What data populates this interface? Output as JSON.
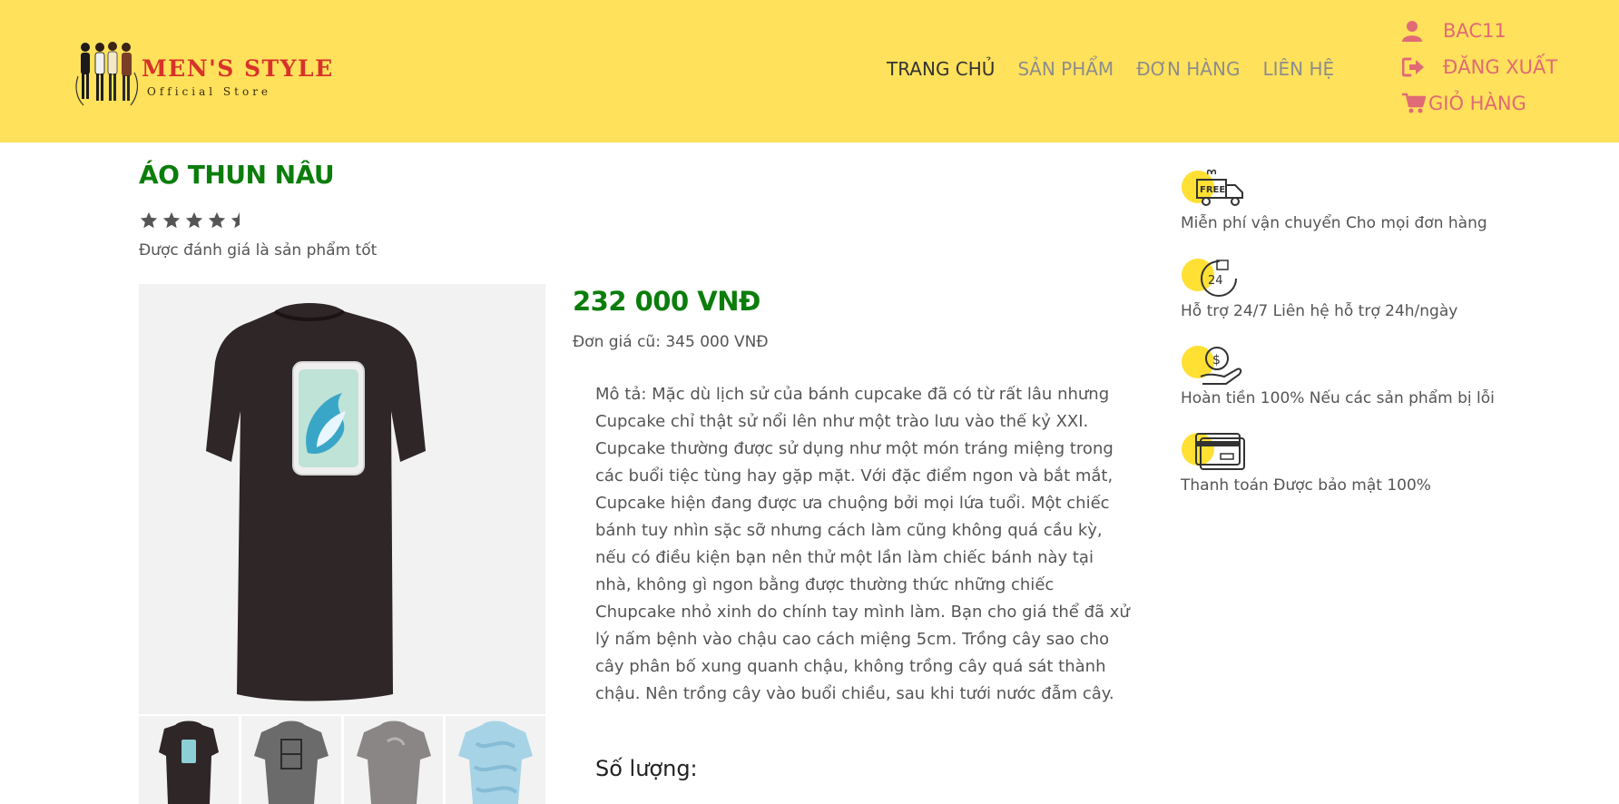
{
  "header": {
    "logo": {
      "title": "MEN'S STYLE",
      "subtitle": "Official Store"
    },
    "nav": [
      {
        "label": "TRANG CHỦ",
        "active": true
      },
      {
        "label": "SẢN PHẨM",
        "active": false
      },
      {
        "label": "ĐƠN HÀNG",
        "active": false
      },
      {
        "label": "LIÊN HỆ",
        "active": false
      }
    ],
    "user": {
      "username": "BAC11",
      "logout_label": "ĐĂNG XUẤT",
      "cart_label": "GIỎ HÀNG"
    }
  },
  "product": {
    "title": "ÁO THUN NÂU",
    "rating": 4.5,
    "rating_text": "Được đánh giá là sản phẩm tốt",
    "price": "232 000 VNĐ",
    "old_price": "Đơn giá cũ: 345 000 VNĐ",
    "description": "Mô tả: Mặc dù lịch sử của bánh cupcake đã có từ rất lâu nhưng Cupcake chỉ thật sử nổi lên như một trào lưu vào thế kỷ XXI. Cupcake thường được sử dụng như một món tráng miệng trong các buổi tiệc tùng hay gặp mặt. Với đặc điểm ngon và bắt mắt, Cupcake hiện đang được ưa chuộng bởi mọi lứa tuổi. Một chiếc bánh tuy nhìn sặc sỡ nhưng cách làm cũng không quá cầu kỳ, nếu có điều kiện bạn nên thử một lần làm chiếc bánh này tại nhà, không gì ngon bằng được thường thức những chiếc Chupcake nhỏ xinh do chính tay mình làm. Bạn cho giá thể đã xử lý nấm bệnh vào chậu cao cách miệng 5cm. Trồng cây sao cho cây phân bố xung quanh chậu, không trồng cây quá sát thành chậu. Nên trồng cây vào buổi chiều, sau khi tưới nước đẫm cây.",
    "quantity_label": "Số lượng:",
    "thumbnails": [
      {
        "color": "#2f2628",
        "accent": "#8ccfd6"
      },
      {
        "color": "#6b6b6b",
        "accent": "#2b2b2b"
      },
      {
        "color": "#8a8686",
        "accent": "#a9a5a5"
      },
      {
        "color": "#a7d3e6",
        "accent": "#86bcd6"
      }
    ]
  },
  "benefits": [
    {
      "icon": "free-shipping-truck-icon",
      "text": "Miễn phí vận chuyển Cho mọi đơn hàng"
    },
    {
      "icon": "support-24-7-icon",
      "text": "Hỗ trợ 24/7 Liên hệ hỗ trợ 24h/ngày"
    },
    {
      "icon": "refund-money-hand-icon",
      "text": "Hoàn tiền 100% Nếu các sản phẩm bị lỗi"
    },
    {
      "icon": "credit-card-icon",
      "text": "Thanh toán Được bảo mật 100%"
    }
  ],
  "colors": {
    "header_bg": "#ffe15b",
    "accent_green": "#0b7d0b",
    "user_pink": "#e06a76",
    "nav_inactive": "#8d8d8d",
    "icon_yellow": "#ffe033"
  }
}
